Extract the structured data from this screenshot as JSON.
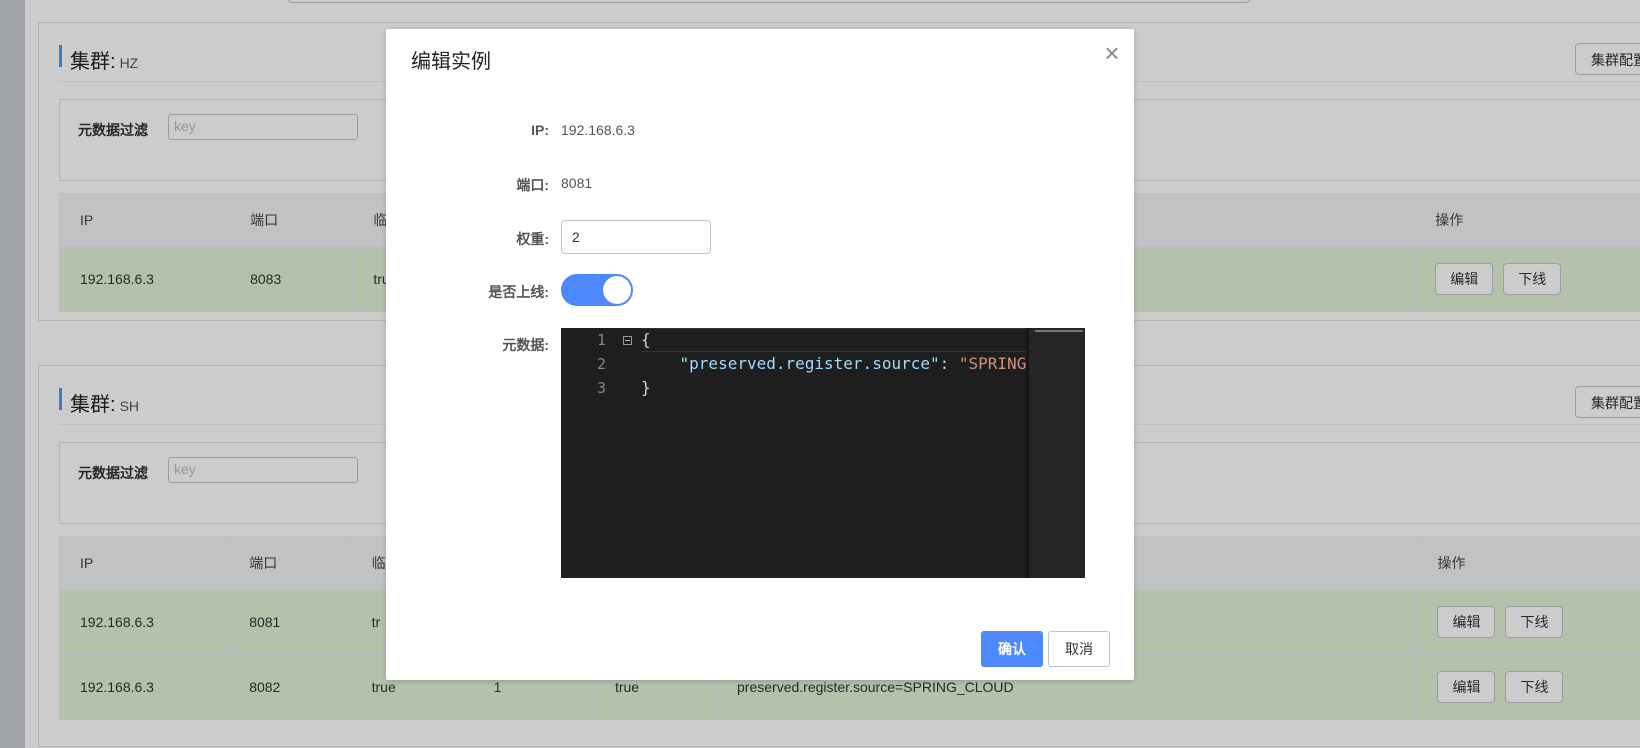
{
  "clusters": [
    {
      "title_label": "集群:",
      "name": "HZ",
      "config_button": "集群配置",
      "filter_label": "元数据过滤",
      "filter_placeholder": "key",
      "columns": [
        "IP",
        "端口",
        "临",
        "",
        "",
        "",
        "操作"
      ],
      "rows": [
        {
          "ip": "192.168.6.3",
          "port": "8083",
          "c3": "tru",
          "c4": "",
          "c5": "",
          "c6": "",
          "edit": "编辑",
          "offline": "下线"
        }
      ]
    },
    {
      "title_label": "集群:",
      "name": "SH",
      "config_button": "集群配置",
      "filter_label": "元数据过滤",
      "filter_placeholder": "key",
      "columns": [
        "IP",
        "端口",
        "临",
        "",
        "",
        "",
        "操作"
      ],
      "rows": [
        {
          "ip": "192.168.6.3",
          "port": "8081",
          "c3": "tr",
          "c4": "",
          "c5": "",
          "c6": "",
          "edit": "编辑",
          "offline": "下线"
        },
        {
          "ip": "192.168.6.3",
          "port": "8082",
          "c3": "true",
          "c4": "1",
          "c5": "true",
          "c6": "preserved.register.source=SPRING_CLOUD",
          "edit": "编辑",
          "offline": "下线"
        }
      ]
    }
  ],
  "dialog": {
    "title": "编辑实例",
    "ip_label": "IP:",
    "ip_value": "192.168.6.3",
    "port_label": "端口:",
    "port_value": "8081",
    "weight_label": "权重:",
    "weight_value": "2",
    "online_label": "是否上线:",
    "online": true,
    "metadata_label": "元数据:",
    "editor": {
      "line_numbers": [
        "1",
        "2",
        "3"
      ],
      "line1": "{",
      "line2_key": "\"preserved.register.source\"",
      "line2_colon": ": ",
      "line2_value": "\"SPRING",
      "line3": "}"
    },
    "confirm_button": "确认",
    "cancel_button": "取消"
  },
  "colors": {
    "primary": "#4d88ff",
    "row_highlight": "#e1f3d8",
    "editor_bg": "#1e1e1e"
  }
}
